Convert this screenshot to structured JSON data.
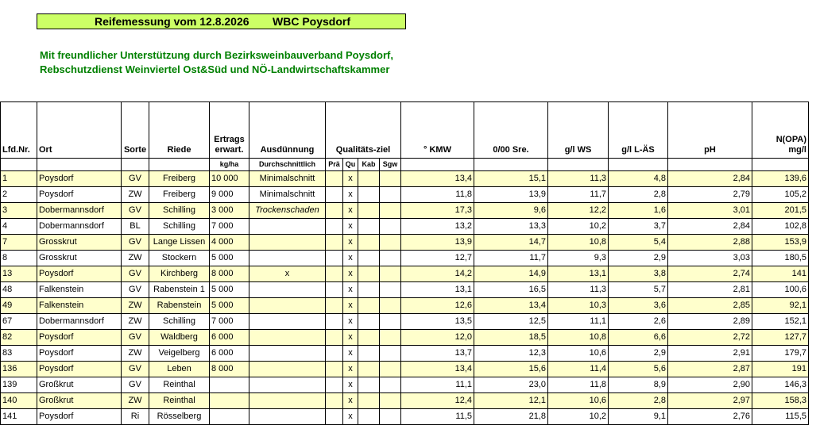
{
  "title": {
    "left": "Reifemessung vom 12.8.2026",
    "right": "WBC Poysdorf"
  },
  "subtitle": {
    "line1": "Mit freundlicher Unterstützung durch Bezirksweinbauverband Poysdorf,",
    "line2": "Rebschutzdienst Weinviertel Ost&Süd und NÖ-Landwirtschaftskammer"
  },
  "headers": {
    "lfd": "Lfd.Nr.",
    "ort": "Ort",
    "sorte": "Sorte",
    "riede": "Riede",
    "ertrag1": "Ertrags",
    "ertrag2": "erwart.",
    "ausd": "Ausdünnung",
    "qual": "Qualitäts-ziel",
    "kmw": "° KMW",
    "sre": "0/00 Sre.",
    "ws": "g/l WS",
    "las": "g/l L-ÄS",
    "ph": "pH",
    "nopa1": "N(OPA)",
    "nopa2": "mg/l"
  },
  "subheaders": {
    "ertrag": "kg/ha",
    "ausd": "Durchschnittlich",
    "pra": "Prä",
    "qu": "Qu",
    "kab": "Kab",
    "sgw": "Sgw"
  },
  "rows": [
    {
      "nr": "1",
      "ort": "Poysdorf",
      "sorte": "GV",
      "riede": "Freiberg",
      "ertrag": "10 000",
      "ausd": "Minimalschnitt",
      "pra": "",
      "qu": "x",
      "kab": "",
      "sgw": "",
      "kmw": "13,4",
      "sre": "15,1",
      "ws": "11,3",
      "las": "4,8",
      "ph": "2,84",
      "nopa": "139,6"
    },
    {
      "nr": "2",
      "ort": "Poysdorf",
      "sorte": "ZW",
      "riede": "Freiberg",
      "ertrag": "9 000",
      "ausd": "Minimalschnitt",
      "pra": "",
      "qu": "x",
      "kab": "",
      "sgw": "",
      "kmw": "11,8",
      "sre": "13,9",
      "ws": "11,7",
      "las": "2,8",
      "ph": "2,79",
      "nopa": "105,2"
    },
    {
      "nr": "3",
      "ort": "Dobermannsdorf",
      "sorte": "GV",
      "riede": "Schilling",
      "ertrag": "3 000",
      "ausd": "Trockenschaden",
      "pra": "",
      "qu": "x",
      "kab": "",
      "sgw": "",
      "kmw": "17,3",
      "sre": "9,6",
      "ws": "12,2",
      "las": "1,6",
      "ph": "3,01",
      "nopa": "201,5"
    },
    {
      "nr": "4",
      "ort": "Dobermannsdorf",
      "sorte": "BL",
      "riede": "Schilling",
      "ertrag": "7 000",
      "ausd": "",
      "pra": "",
      "qu": "x",
      "kab": "",
      "sgw": "",
      "kmw": "13,2",
      "sre": "13,3",
      "ws": "10,2",
      "las": "3,7",
      "ph": "2,84",
      "nopa": "102,8"
    },
    {
      "nr": "7",
      "ort": "Grosskrut",
      "sorte": "GV",
      "riede": "Lange Lissen",
      "ertrag": "4 000",
      "ausd": "",
      "pra": "",
      "qu": "x",
      "kab": "",
      "sgw": "",
      "kmw": "13,9",
      "sre": "14,7",
      "ws": "10,8",
      "las": "5,4",
      "ph": "2,88",
      "nopa": "153,9"
    },
    {
      "nr": "8",
      "ort": "Grosskrut",
      "sorte": "ZW",
      "riede": "Stockern",
      "ertrag": "5 000",
      "ausd": "",
      "pra": "",
      "qu": "x",
      "kab": "",
      "sgw": "",
      "kmw": "12,7",
      "sre": "11,7",
      "ws": "9,3",
      "las": "2,9",
      "ph": "3,03",
      "nopa": "180,5"
    },
    {
      "nr": "13",
      "ort": "Poysdorf",
      "sorte": "GV",
      "riede": "Kirchberg",
      "ertrag": "8 000",
      "ausd": "x",
      "pra": "",
      "qu": "x",
      "kab": "",
      "sgw": "",
      "kmw": "14,2",
      "sre": "14,9",
      "ws": "13,1",
      "las": "3,8",
      "ph": "2,74",
      "nopa": "141"
    },
    {
      "nr": "48",
      "ort": "Falkenstein",
      "sorte": "GV",
      "riede": "Rabenstein 1",
      "ertrag": "5 000",
      "ausd": "",
      "pra": "",
      "qu": "x",
      "kab": "",
      "sgw": "",
      "kmw": "13,1",
      "sre": "16,5",
      "ws": "11,3",
      "las": "5,7",
      "ph": "2,81",
      "nopa": "100,6"
    },
    {
      "nr": "49",
      "ort": "Falkenstein",
      "sorte": "ZW",
      "riede": "Rabenstein",
      "ertrag": "5 000",
      "ausd": "",
      "pra": "",
      "qu": "x",
      "kab": "",
      "sgw": "",
      "kmw": "12,6",
      "sre": "13,4",
      "ws": "10,3",
      "las": "3,6",
      "ph": "2,85",
      "nopa": "92,1"
    },
    {
      "nr": "67",
      "ort": "Dobermannsdorf",
      "sorte": "ZW",
      "riede": "Schilling",
      "ertrag": "7 000",
      "ausd": "",
      "pra": "",
      "qu": "x",
      "kab": "",
      "sgw": "",
      "kmw": "13,5",
      "sre": "12,5",
      "ws": "11,1",
      "las": "2,6",
      "ph": "2,89",
      "nopa": "152,1"
    },
    {
      "nr": "82",
      "ort": "Poysdorf",
      "sorte": "GV",
      "riede": "Waldberg",
      "ertrag": "6 000",
      "ausd": "",
      "pra": "",
      "qu": "x",
      "kab": "",
      "sgw": "",
      "kmw": "12,0",
      "sre": "18,5",
      "ws": "10,8",
      "las": "6,6",
      "ph": "2,72",
      "nopa": "127,7"
    },
    {
      "nr": "83",
      "ort": "Poysdorf",
      "sorte": "ZW",
      "riede": "Veigelberg",
      "ertrag": "6 000",
      "ausd": "",
      "pra": "",
      "qu": "x",
      "kab": "",
      "sgw": "",
      "kmw": "13,7",
      "sre": "12,3",
      "ws": "10,6",
      "las": "2,9",
      "ph": "2,91",
      "nopa": "179,7"
    },
    {
      "nr": "136",
      "ort": "Poysdorf",
      "sorte": "GV",
      "riede": "Leben",
      "ertrag": "8 000",
      "ausd": "",
      "pra": "",
      "qu": "x",
      "kab": "",
      "sgw": "",
      "kmw": "13,4",
      "sre": "15,6",
      "ws": "11,4",
      "las": "5,6",
      "ph": "2,87",
      "nopa": "191"
    },
    {
      "nr": "139",
      "ort": "Großkrut",
      "sorte": "GV",
      "riede": "Reinthal",
      "ertrag": "",
      "ausd": "",
      "pra": "",
      "qu": "x",
      "kab": "",
      "sgw": "",
      "kmw": "11,1",
      "sre": "23,0",
      "ws": "11,8",
      "las": "8,9",
      "ph": "2,90",
      "nopa": "146,3"
    },
    {
      "nr": "140",
      "ort": "Großkrut",
      "sorte": "ZW",
      "riede": "Reinthal",
      "ertrag": "",
      "ausd": "",
      "pra": "",
      "qu": "x",
      "kab": "",
      "sgw": "",
      "kmw": "12,4",
      "sre": "12,1",
      "ws": "10,6",
      "las": "2,8",
      "ph": "2,97",
      "nopa": "158,3"
    },
    {
      "nr": "141",
      "ort": "Poysdorf",
      "sorte": "Ri",
      "riede": "Rösselberg",
      "ertrag": "",
      "ausd": "",
      "pra": "",
      "qu": "x",
      "kab": "",
      "sgw": "",
      "kmw": "11,5",
      "sre": "21,8",
      "ws": "10,2",
      "las": "9,1",
      "ph": "2,76",
      "nopa": "115,5"
    }
  ],
  "colors": {
    "title_bg": "#ccff66",
    "subtitle": "#008000",
    "row_highlight": "#ffffcc"
  }
}
